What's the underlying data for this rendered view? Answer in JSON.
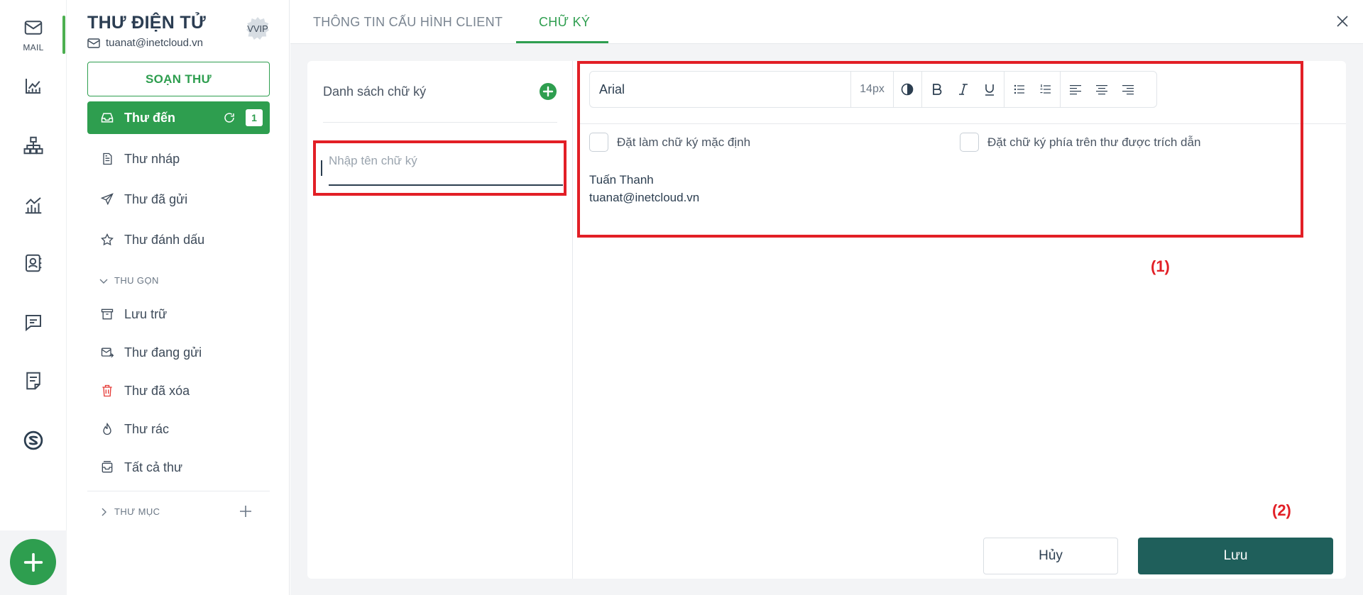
{
  "rail": {
    "items": [
      {
        "icon": "mail-icon",
        "label": "MAIL"
      },
      {
        "icon": "chart-line-icon"
      },
      {
        "icon": "org-chart-icon"
      },
      {
        "icon": "bar-chart-icon"
      },
      {
        "icon": "contacts-icon"
      },
      {
        "icon": "chat-icon"
      },
      {
        "icon": "notes-icon"
      },
      {
        "icon": "app-logo-icon"
      }
    ],
    "fab_icon": "plus-icon"
  },
  "mailbox": {
    "title": "THƯ ĐIỆN TỬ",
    "email": "tuanat@inetcloud.vn",
    "tier_badge": "VVIP",
    "compose_label": "SOẠN THƯ",
    "folders": [
      {
        "label": "Thư đến",
        "icon": "inbox-icon",
        "count": "1",
        "active": true
      },
      {
        "label": "Thư nháp",
        "icon": "draft-icon"
      },
      {
        "label": "Thư đã gửi",
        "icon": "send-icon"
      },
      {
        "label": "Thư đánh dấu",
        "icon": "star-icon"
      }
    ],
    "collapse_label": "THU GỌN",
    "more_folders": [
      {
        "label": "Lưu trữ",
        "icon": "archive-icon"
      },
      {
        "label": "Thư đang gửi",
        "icon": "outbox-icon"
      },
      {
        "label": "Thư đã xóa",
        "icon": "trash-icon"
      },
      {
        "label": "Thư rác",
        "icon": "spam-icon"
      },
      {
        "label": "Tất cả thư",
        "icon": "all-mail-icon"
      }
    ],
    "custom_folders_label": "THƯ MỤC"
  },
  "tabs": [
    {
      "label": "THÔNG TIN CẤU HÌNH CLIENT",
      "active": false
    },
    {
      "label": "CHỮ KÝ",
      "active": true
    }
  ],
  "signatures": {
    "list_title": "Danh sách chữ ký",
    "name_placeholder": "Nhập tên chữ ký",
    "name_value": ""
  },
  "editor": {
    "font": "Arial",
    "size": "14px",
    "toolbar_icons": [
      "contrast-icon",
      "bold-icon",
      "italic-icon",
      "underline-icon",
      "bullet-list-icon",
      "numbered-list-icon",
      "align-left-icon",
      "align-center-icon",
      "align-right-icon"
    ],
    "default_checkbox_label": "Đặt làm chữ ký mặc định",
    "above_quote_checkbox_label": "Đặt chữ ký phía trên thư được trích dẫn",
    "content_lines": [
      "Tuấn Thanh",
      "tuanat@inetcloud.vn"
    ]
  },
  "annotations": {
    "editor_marker": "(1)",
    "save_marker": "(2)"
  },
  "actions": {
    "cancel_label": "Hủy",
    "save_label": "Lưu"
  },
  "colors": {
    "brand_green": "#2e9e4f",
    "save_button": "#1f5f5b",
    "highlight_red": "#e21f26"
  }
}
